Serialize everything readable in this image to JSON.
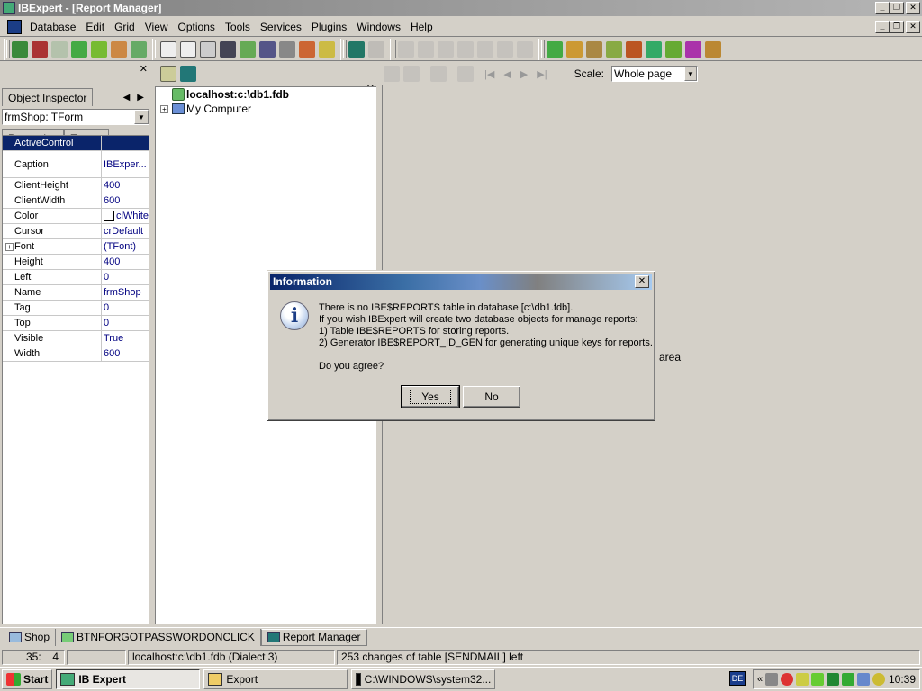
{
  "window": {
    "title": "IBExpert - [Report Manager]"
  },
  "menu": {
    "items": [
      "Database",
      "Edit",
      "Grid",
      "View",
      "Options",
      "Tools",
      "Services",
      "Plugins",
      "Windows",
      "Help"
    ]
  },
  "object_inspector": {
    "tab_label": "Object Inspector",
    "selected_object": "frmShop: TForm",
    "tabs": [
      "Properties",
      "Events"
    ],
    "properties": [
      {
        "name": "ActiveControl",
        "value": ""
      },
      {
        "name": "Caption",
        "value": "IBExper..."
      },
      {
        "name": "ClientHeight",
        "value": "400"
      },
      {
        "name": "ClientWidth",
        "value": "600"
      },
      {
        "name": "Color",
        "value": "clWhite"
      },
      {
        "name": "Cursor",
        "value": "crDefault"
      },
      {
        "name": "Font",
        "value": "(TFont)"
      },
      {
        "name": "Height",
        "value": "400"
      },
      {
        "name": "Left",
        "value": "0"
      },
      {
        "name": "Name",
        "value": "frmShop"
      },
      {
        "name": "Tag",
        "value": "0"
      },
      {
        "name": "Top",
        "value": "0"
      },
      {
        "name": "Visible",
        "value": "True"
      },
      {
        "name": "Width",
        "value": "600"
      }
    ]
  },
  "tree": {
    "nodes": [
      {
        "label": "localhost:c:\\db1.fdb"
      },
      {
        "label": "My Computer"
      }
    ]
  },
  "report_toolbar": {
    "scale_label": "Scale:",
    "scale_value": "Whole page"
  },
  "report_area": {
    "label": "area"
  },
  "dialog": {
    "title": "Information",
    "icon": "information-icon",
    "lines": [
      "There is no IBE$REPORTS table in database [c:\\db1.fdb].",
      "If you wish IBExpert will create two database objects for manage reports:",
      "1) Table IBE$REPORTS for storing reports.",
      "2) Generator IBE$REPORT_ID_GEN for generating unique keys for reports."
    ],
    "question": "Do you agree?",
    "yes_label": "Yes",
    "no_label": "No"
  },
  "mdi_tabs": [
    {
      "label": "Shop"
    },
    {
      "label": "BTNFORGOTPASSWORDONCLICK"
    },
    {
      "label": "Report Manager"
    }
  ],
  "statusbar": {
    "position": "35:",
    "col": "4",
    "connection": "localhost:c:\\db1.fdb (Dialect 3)",
    "message": "253 changes of table [SENDMAIL] left"
  },
  "taskbar": {
    "start_label": "Start",
    "tasks": [
      {
        "label": "IB Expert"
      },
      {
        "label": "Export"
      },
      {
        "label": "C:\\WINDOWS\\system32..."
      }
    ],
    "lang": "DE",
    "clock": "10:39"
  }
}
